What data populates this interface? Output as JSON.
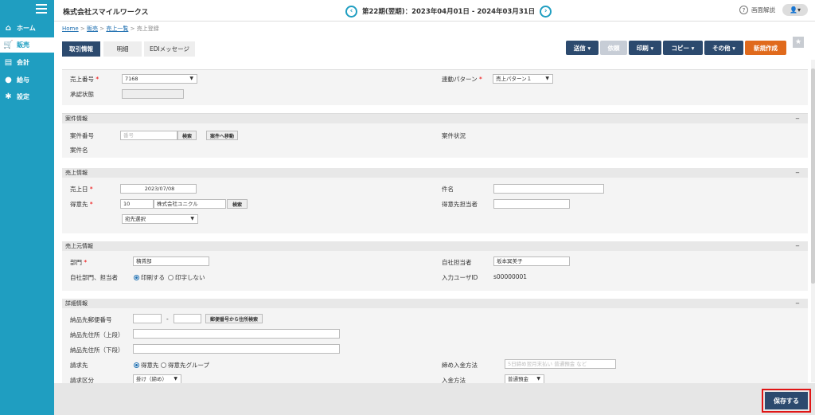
{
  "sidebar": {
    "items": [
      {
        "label": "ホーム",
        "icon": "home-icon"
      },
      {
        "label": "販売",
        "icon": "cart-icon"
      },
      {
        "label": "会計",
        "icon": "calculator-icon"
      },
      {
        "label": "給与",
        "icon": "money-bag-icon"
      },
      {
        "label": "設定",
        "icon": "gear-icon"
      }
    ]
  },
  "header": {
    "company": "株式会社スマイルワークス",
    "period": "第22期(翌期)：2023年04月01日 - 2024年03月31日",
    "help": "画面解説",
    "user_caret": "▾"
  },
  "breadcrumb": {
    "home": "Home",
    "sales": "販売",
    "list": "売上一覧",
    "current": "売上登録",
    "sep": ">"
  },
  "tabs": [
    "取引情報",
    "明細",
    "EDIメッセージ"
  ],
  "actions": {
    "send": "送信 ▾",
    "request": "依頼",
    "print": "印刷 ▾",
    "copy": "コピー ▾",
    "other": "その他 ▾",
    "new": "新規作成"
  },
  "form": {
    "sales_no_label": "売上番号",
    "sales_no": "7168",
    "link_pattern_label": "連動パターン",
    "link_pattern": "売上パターン１",
    "approval_label": "承認状態",
    "case_section": "案件情報",
    "case_no_label": "案件番号",
    "case_no_placeholder": "番号",
    "search": "検索",
    "goto_case": "案件へ移動",
    "case_status_label": "案件状況",
    "case_name_label": "案件名",
    "sales_section": "売上情報",
    "sales_date_label": "売上日",
    "sales_date": "2023/07/08",
    "subject_label": "件名",
    "customer_label": "得意先",
    "customer_code": "10",
    "customer_name": "株式会社ユニクル",
    "customer_contact_label": "得意先担当者",
    "dest_select": "宛先選択",
    "origin_section": "売上元情報",
    "dept_label": "部門",
    "dept": "積賃部",
    "staff_label": "自社担当者",
    "staff": "坂本冥美子",
    "print_label": "自社部門、担当者",
    "print_yes": "印刷する",
    "print_no": "印字しない",
    "input_user_label": "入力ユーザID",
    "input_user": "s00000001",
    "detail_section": "詳細情報",
    "zip_label": "納品先郵便番号",
    "zip_search": "郵便番号から住所検索",
    "addr1_label": "納品先住所（上段）",
    "addr2_label": "納品先住所（下段）",
    "bill_to_label": "請求先",
    "bill_to_1": "得意先",
    "bill_to_2": "得意先グループ",
    "closing_label": "締め入金方法",
    "closing_placeholder": "5日締め翌月末払い 普通預金 など",
    "bill_type_label": "請求区分",
    "bill_type": "掛け（締め）",
    "payment_label": "入金方法",
    "payment": "普通預金"
  },
  "footer": {
    "save": "保存する"
  }
}
